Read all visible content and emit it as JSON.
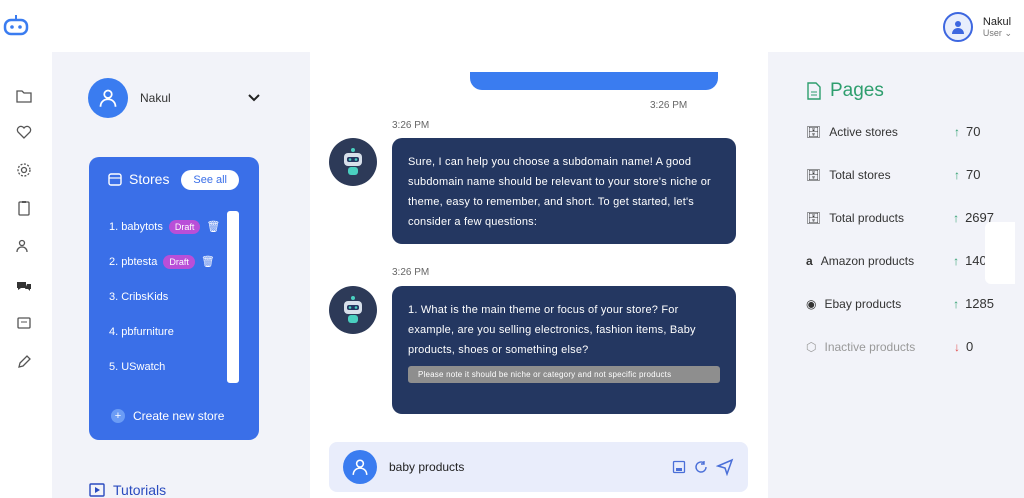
{
  "colors": {
    "accent": "#3a6fe8",
    "green": "#2e9e6e",
    "bubble": "#243761",
    "draft": "#b94fd8"
  },
  "user": {
    "name": "Nakul",
    "role": "User"
  },
  "profile": {
    "name": "Nakul"
  },
  "stores": {
    "title": "Stores",
    "see_all": "See all",
    "items": [
      {
        "label": "1. babytots",
        "badge": "Draft"
      },
      {
        "label": "2. pbtesta",
        "badge": "Draft"
      },
      {
        "label": "3. CribsKids"
      },
      {
        "label": "4. pbfurniture"
      },
      {
        "label": "5. USwatch"
      }
    ],
    "create": "Create new store"
  },
  "tutorials": {
    "label": "Tutorials"
  },
  "chat": {
    "time_user": "3:26 PM",
    "time_bot1": "3:26 PM",
    "msg1": "Sure, I can help you choose a subdomain name! A good subdomain name should be relevant to your store's niche or theme, easy to remember, and short. To get started, let's consider a few questions:",
    "time_bot2": "3:26 PM",
    "msg2": "1. What is the main theme or focus of your store? For example, are you selling electronics, fashion items, Baby products, shoes or something else?",
    "note": "Please note it should be niche or category and not specific products",
    "input_value": "baby products"
  },
  "pages": {
    "title": "Pages",
    "rows": [
      {
        "icon": "store-icon",
        "label": "Active stores",
        "arrow": "↑",
        "value": "70"
      },
      {
        "icon": "store-icon",
        "label": "Total stores",
        "arrow": "↑",
        "value": "70"
      },
      {
        "icon": "store-icon",
        "label": "Total products",
        "arrow": "↑",
        "value": "2697"
      },
      {
        "icon": "amazon-icon",
        "label": "Amazon products",
        "arrow": "↑",
        "value": "1406"
      },
      {
        "icon": "ebay-icon",
        "label": "Ebay products",
        "arrow": "↑",
        "value": "1285"
      },
      {
        "icon": "box-icon",
        "label": "Inactive products",
        "arrow": "↓",
        "value": "0"
      }
    ]
  }
}
